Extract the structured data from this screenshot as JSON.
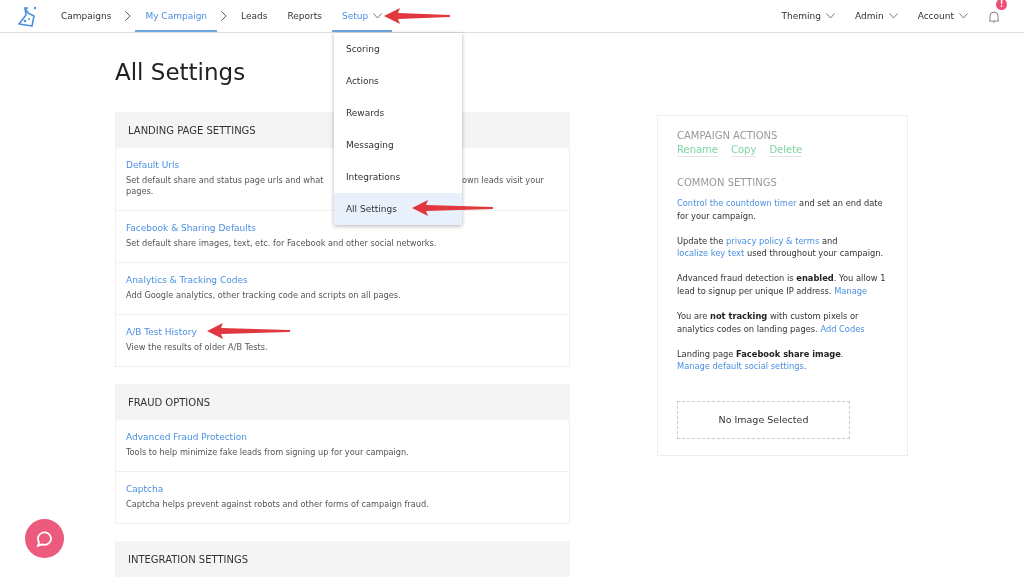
{
  "nav": {
    "left": [
      {
        "label": "Campaigns",
        "kind": "crumb",
        "selected": false
      },
      {
        "label": "My Campaign",
        "kind": "crumb",
        "selected": true
      },
      {
        "label": "Leads",
        "kind": "link",
        "selected": false
      },
      {
        "label": "Reports",
        "kind": "link",
        "selected": false
      },
      {
        "label": "Setup",
        "kind": "menu",
        "selected": true,
        "expanded": true,
        "menu_items": [
          {
            "label": "Scoring",
            "selected": false
          },
          {
            "label": "Actions",
            "selected": false
          },
          {
            "label": "Rewards",
            "selected": false
          },
          {
            "label": "Messaging",
            "selected": false
          },
          {
            "label": "Integrations",
            "selected": false
          },
          {
            "label": "All Settings",
            "selected": true
          }
        ]
      }
    ],
    "right": [
      {
        "label": "Theming",
        "kind": "menu",
        "selected": false
      },
      {
        "label": "Admin",
        "kind": "menu",
        "selected": false
      },
      {
        "label": "Account",
        "kind": "menu",
        "selected": false
      }
    ],
    "notifications": {
      "badge": "!"
    }
  },
  "page": {
    "title": "All Settings"
  },
  "sections": [
    {
      "title": "LANDING PAGE SETTINGS",
      "items": [
        {
          "title": "Default Urls",
          "description": "Set default share and status page urls and what",
          "description_continued": "own leads visit your",
          "description_end": "pages."
        },
        {
          "title": "Facebook & Sharing Defaults",
          "description": "Set default share images, text, etc. for Facebook and other social networks."
        },
        {
          "title": "Analytics & Tracking Codes",
          "description": "Add Google analytics, other tracking code and scripts on all pages."
        },
        {
          "title": "A/B Test History",
          "description": "View the results of older A/B Tests."
        }
      ]
    },
    {
      "title": "FRAUD OPTIONS",
      "items": [
        {
          "title": "Advanced Fraud Protection",
          "description": "Tools to help minimize fake leads from signing up for your campaign."
        },
        {
          "title": "Captcha",
          "description": "Captcha helps prevent against robots and other forms of campaign fraud."
        }
      ]
    },
    {
      "title": "INTEGRATION SETTINGS"
    }
  ],
  "side_panel": {
    "campaign_actions": {
      "title": "CAMPAIGN ACTIONS",
      "actions": [
        "Rename",
        "Copy",
        "Delete"
      ]
    },
    "common_settings": {
      "title": "COMMON SETTINGS",
      "paragraphs": [
        [
          {
            "kind": "link",
            "text": "Control the countdown timer"
          },
          {
            "kind": "text",
            "text": " and set an end date for your campaign."
          }
        ],
        [
          {
            "kind": "text",
            "text": "Update the "
          },
          {
            "kind": "link",
            "text": "privacy policy & terms"
          },
          {
            "kind": "text",
            "text": " and "
          },
          {
            "kind": "link",
            "text": "localize key text"
          },
          {
            "kind": "text",
            "text": " used throughout your campaign."
          }
        ],
        [
          {
            "kind": "text",
            "text": "Advanced fraud detection is "
          },
          {
            "kind": "bold",
            "text": "enabled"
          },
          {
            "kind": "text",
            "text": ". You allow 1 lead to signup per unique IP address. "
          },
          {
            "kind": "link",
            "text": "Manage"
          }
        ],
        [
          {
            "kind": "text",
            "text": "You are "
          },
          {
            "kind": "bold",
            "text": "not tracking"
          },
          {
            "kind": "text",
            "text": " with custom pixels or analytics codes on landing pages. "
          },
          {
            "kind": "link",
            "text": "Add Codes"
          }
        ],
        [
          {
            "kind": "text",
            "text": "Landing page "
          },
          {
            "kind": "bold",
            "text": "Facebook share image"
          },
          {
            "kind": "text",
            "text": ". "
          },
          {
            "kind": "link",
            "text": "Manage default social settings"
          },
          {
            "kind": "text",
            "text": "."
          }
        ]
      ]
    },
    "image_box": {
      "text": "No Image Selected"
    }
  }
}
